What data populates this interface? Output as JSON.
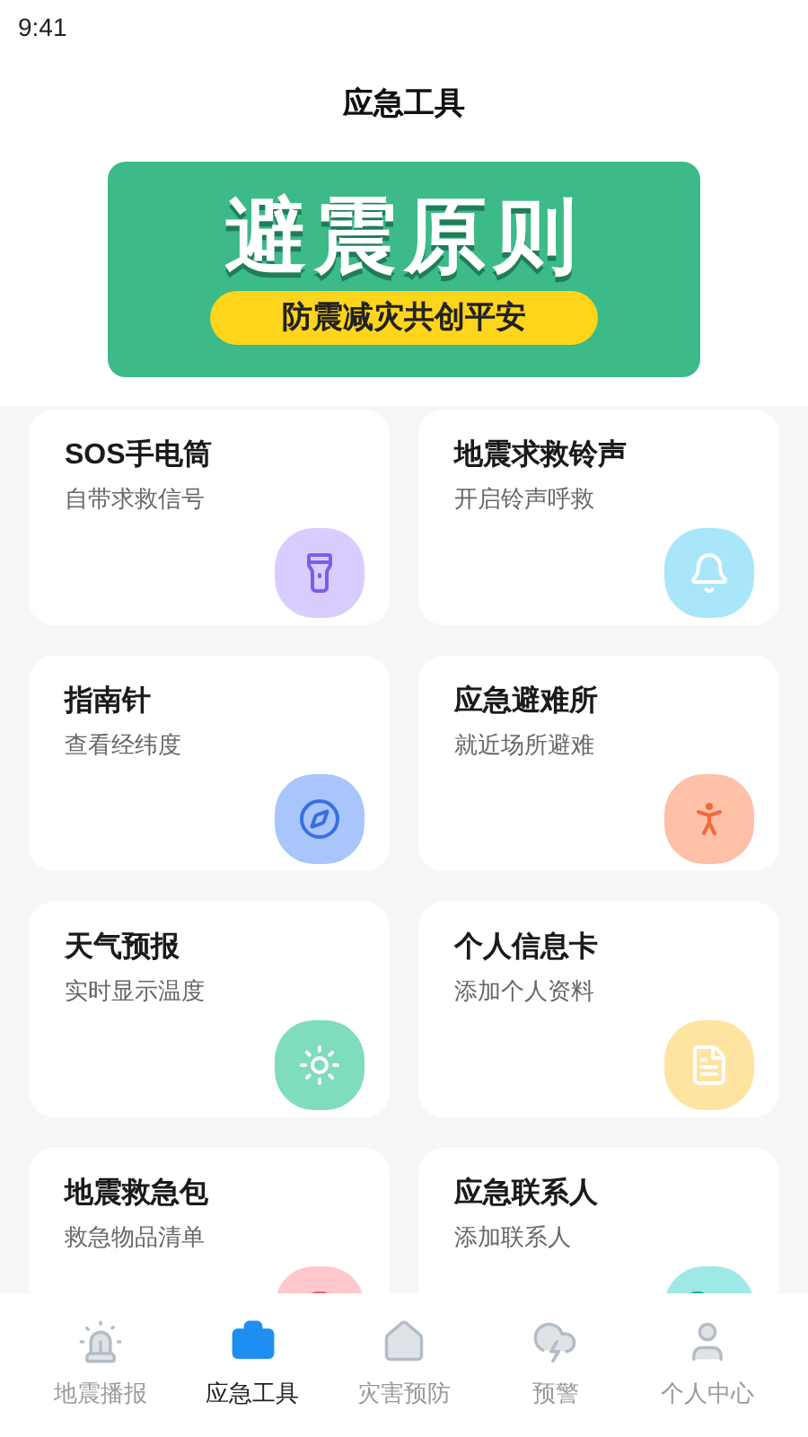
{
  "status_bar": {
    "time": "9:41"
  },
  "header": {
    "title": "应急工具"
  },
  "banner": {
    "title": "避震原则",
    "slogan": "防震减灾共创平安"
  },
  "tools": [
    {
      "title": "SOS手电筒",
      "subtitle": "自带求救信号",
      "color": "#d9ccff"
    },
    {
      "title": "地震求救铃声",
      "subtitle": "开启铃声呼救",
      "color": "#a9e6fa"
    },
    {
      "title": "指南针",
      "subtitle": "查看经纬度",
      "color": "#a8c6fb"
    },
    {
      "title": "应急避难所",
      "subtitle": "就近场所避难",
      "color": "#ffc0a8"
    },
    {
      "title": "天气预报",
      "subtitle": "实时显示温度",
      "color": "#7fdcbc"
    },
    {
      "title": "个人信息卡",
      "subtitle": "添加个人资料",
      "color": "#ffe3a0"
    },
    {
      "title": "地震救急包",
      "subtitle": "救急物品清单",
      "color": "#ffc8cc"
    },
    {
      "title": "应急联系人",
      "subtitle": "添加联系人",
      "color": "#9ee9e6"
    }
  ],
  "tab_bar": [
    {
      "label": "地震播报",
      "selected": false
    },
    {
      "label": "应急工具",
      "selected": true
    },
    {
      "label": "灾害预防",
      "selected": false
    },
    {
      "label": "预警",
      "selected": false
    },
    {
      "label": "个人中心",
      "selected": false
    }
  ]
}
